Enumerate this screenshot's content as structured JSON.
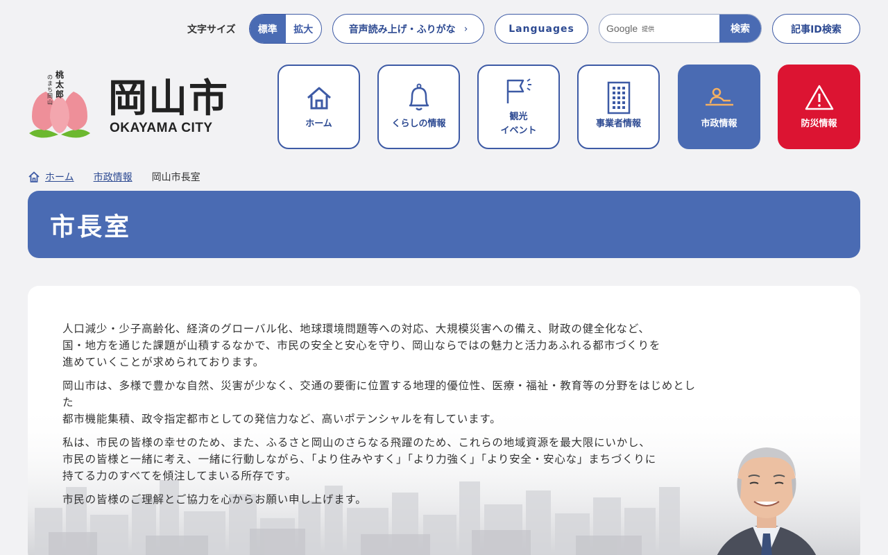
{
  "utility": {
    "font_size_label": "文字サイズ",
    "font_sizes": [
      "標準",
      "拡大"
    ],
    "font_size_selected": "標準",
    "read_aloud_label": "音声読み上げ・ふりがな",
    "languages_label": "Languages",
    "search": {
      "brand": "Google",
      "provided": "提供",
      "button": "検索",
      "value": ""
    },
    "article_id_label": "記事ID検索"
  },
  "logo": {
    "city_name": "岡山市",
    "city_name_en": "OKAYAMA CITY",
    "tagline_vertical": "桃太郎のまち岡山"
  },
  "nav": [
    {
      "label": "ホーム",
      "icon": "home-icon"
    },
    {
      "label": "くらしの情報",
      "icon": "bell-icon"
    },
    {
      "label": "観光\nイベント",
      "icon": "flag-icon"
    },
    {
      "label": "事業者情報",
      "icon": "building-icon"
    },
    {
      "label": "市政情報",
      "icon": "podium-icon",
      "active": true
    },
    {
      "label": "防災情報",
      "icon": "warning-icon",
      "danger": true
    }
  ],
  "breadcrumb": [
    {
      "label": "ホーム",
      "link": true
    },
    {
      "label": "市政情報",
      "link": true
    },
    {
      "label": "岡山市長室",
      "link": false
    }
  ],
  "page_title": "市長室",
  "message": {
    "p1": [
      "人口減少・少子高齢化、経済のグローバル化、地球環境問題等への対応、大規模災害への備え、財政の健全化など、",
      "国・地方を通じた課題が山積するなかで、市民の安全と安心を守り、岡山ならではの魅力と活力あふれる都市づくりを",
      "進めていくことが求められております。"
    ],
    "p2": [
      "岡山市は、多様で豊かな自然、災害が少なく、交通の要衝に位置する地理的優位性、医療・福祉・教育等の分野をはじめとし",
      "た",
      "都市機能集積、政令指定都市としての発信力など、高いポテンシャルを有しています。"
    ],
    "p3": [
      "私は、市民の皆様の幸せのため、また、ふるさと岡山のさらなる飛躍のため、これらの地域資源を最大限にいかし、",
      "市民の皆様と一緒に考え、一緒に行動しながら、「より住みやすく」「より力強く」「より安全・安心な」まちづくりに",
      "持てる力のすべてを傾注してまいる所存です。"
    ],
    "p4": [
      "市民の皆様のご理解とご協力を心からお願い申し上げます。"
    ]
  },
  "colors": {
    "primary": "#4a6bb3",
    "primary_dark": "#2d4a92",
    "danger": "#dc1432",
    "background": "#f2f2f4"
  }
}
